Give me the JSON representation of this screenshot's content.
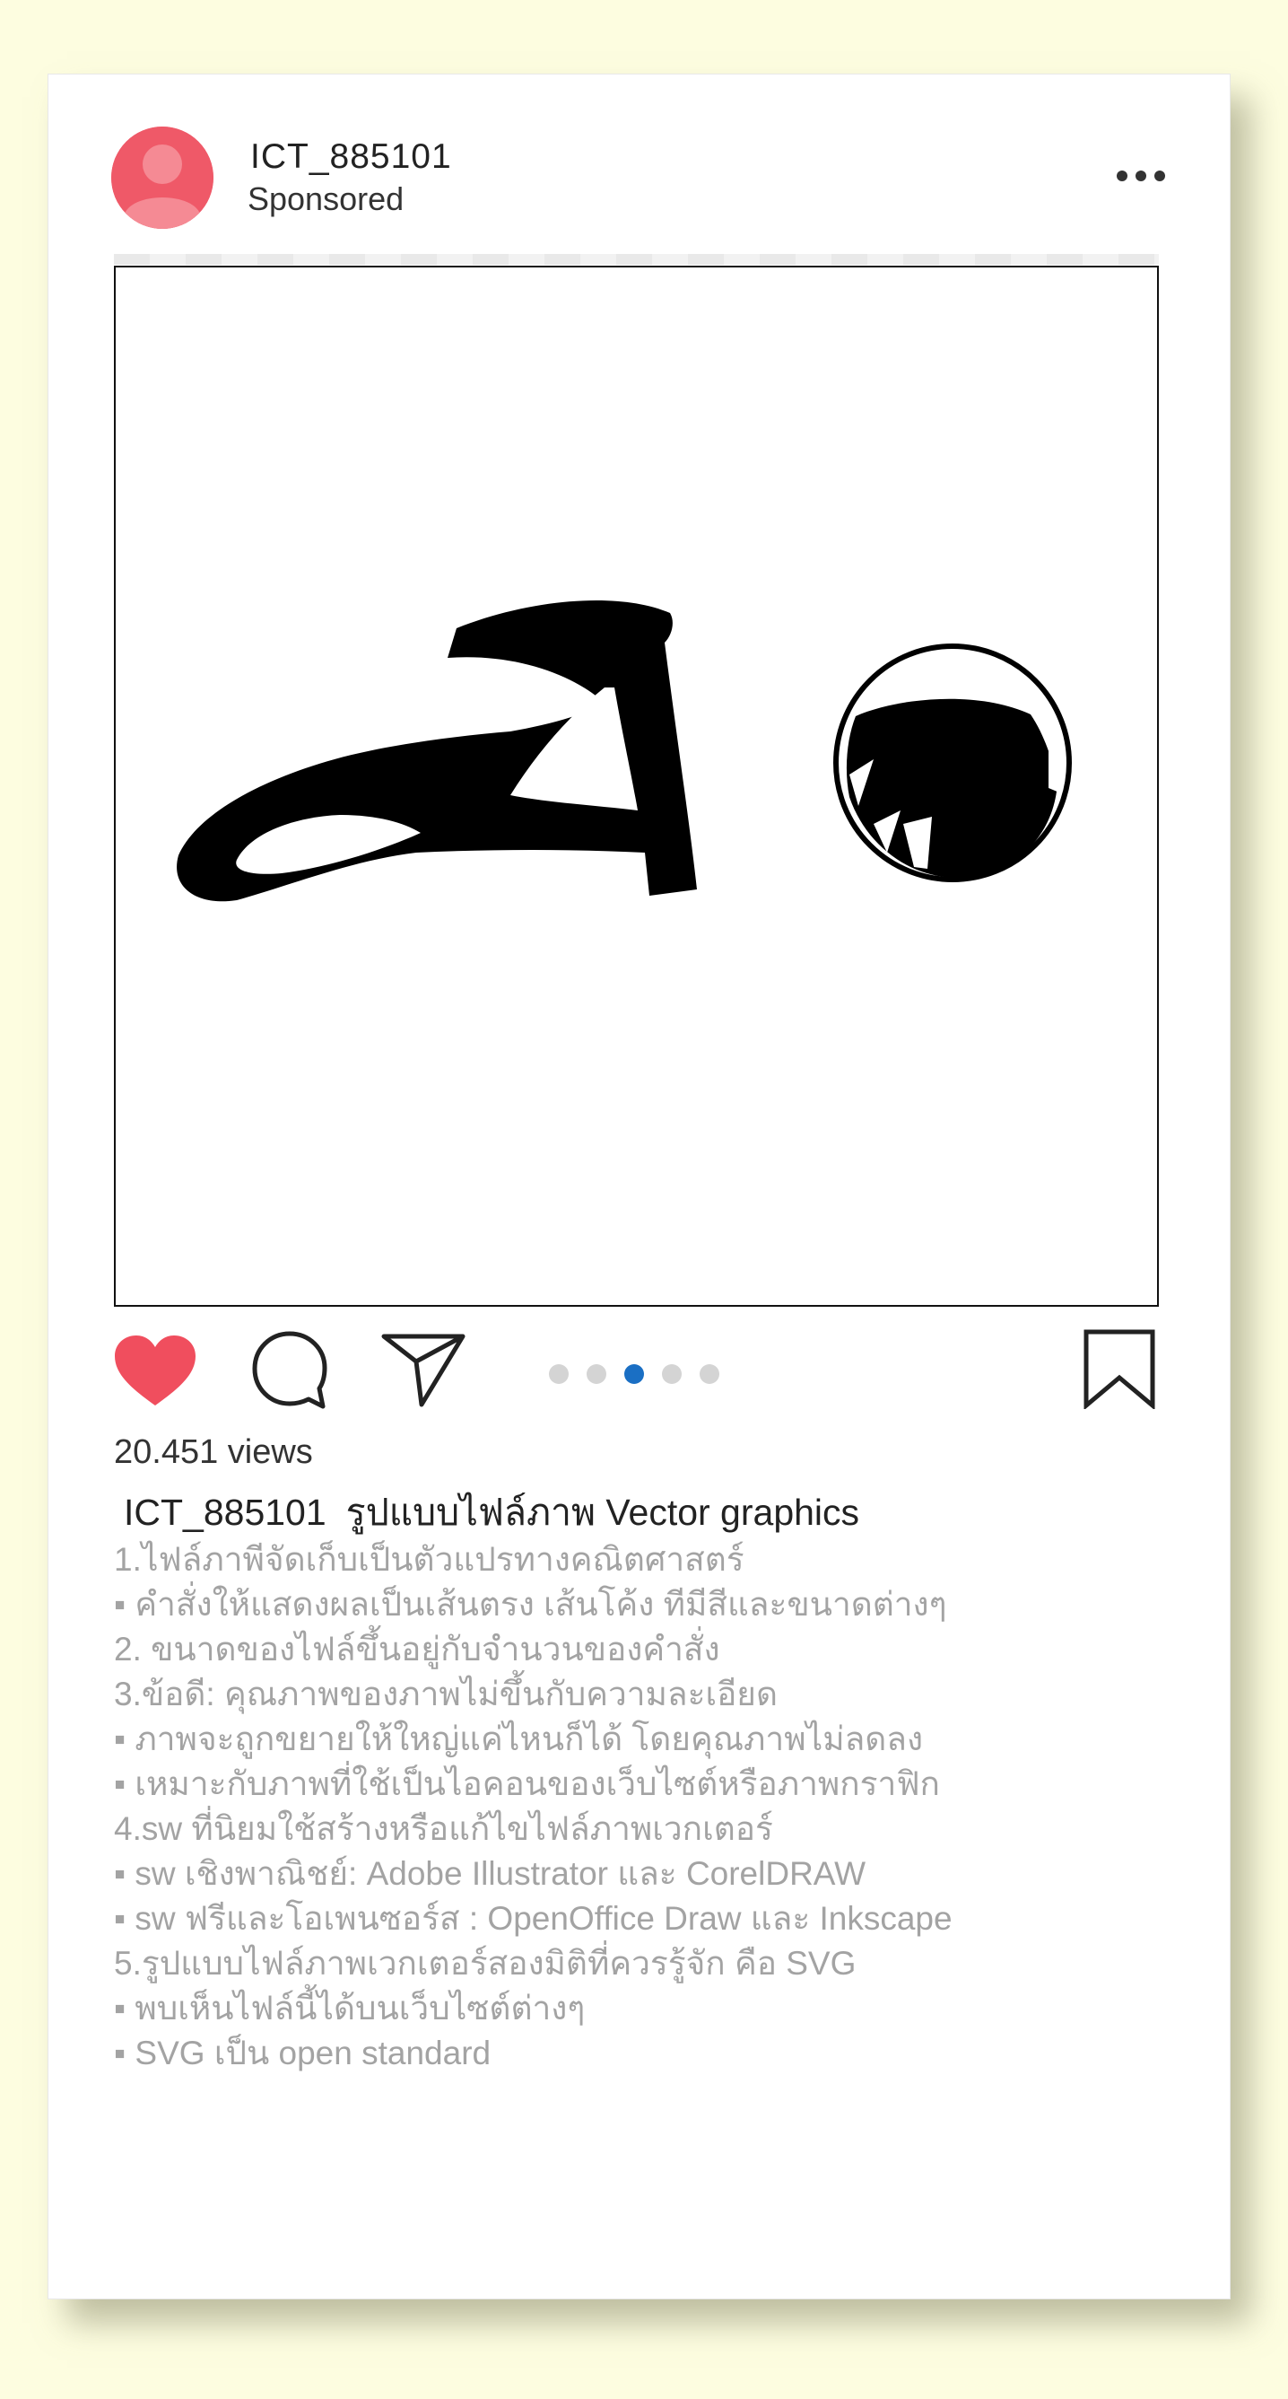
{
  "post": {
    "username": "ICT_885101",
    "sponsored_label": "Sponsored",
    "views": "20.451 views",
    "caption": {
      "username": "ICT_885101",
      "text": "รูปแบบไฟล์ภาพ Vector graphics"
    },
    "description_lines": [
      "1.ไฟล์ภาพีจัดเก็บเป็นตัวแปรทางคณิตศาสตร์",
      "▪ คำสั่งให้แสดงผลเป็นเส้นตรง เส้นโค้ง ทีมีสีและขนาดต่างๆ",
      "2. ขนาดของไฟล์ขึ้นอยู่กับจำนวนของคำสั่ง",
      "3.ข้อดี: คุณภาพของภาพไม่ขึ้นกับความละเอียด",
      "▪ ภาพจะถูกขยายให้ใหญ่แค่ไหนก็ได้ โดยคุณภาพไม่ลดลง",
      "▪ เหมาะกับภาพที่ใช้เป็นไอคอนของเว็บไซต์หรือภาพกราฟิก",
      "4.sw ที่นิยมใช้สร้างหรือแก้ไขไฟล์ภาพเวกเตอร์",
      "▪ sw เชิงพาณิชย์: Adobe Illustrator และ CorelDRAW",
      "▪ sw ฟรีและโอเพนซอร์ส : OpenOffice Draw และ Inkscape",
      "5.รูปแบบไฟล์ภาพเวกเตอร์สองมิติที่ควรรู้จัก คือ SVG",
      "▪ พบเห็นไฟล์นี้ได้บนเว็บไซต์ต่างๆ",
      "▪ SVG เป็น open standard"
    ],
    "carousel": {
      "total": 5,
      "active_index": 2
    }
  },
  "icons": {
    "avatar": "person-icon",
    "more": "ellipsis-icon",
    "like": "heart-icon",
    "comment": "speech-bubble-icon",
    "share": "paper-plane-icon",
    "save": "bookmark-icon"
  },
  "colors": {
    "background": "#fdfde0",
    "avatar": "#ef5968",
    "heart": "#f04e5e",
    "active_dot": "#1a6fc4",
    "inactive_dot": "#d4d4d4",
    "description_text": "#a3a3a3"
  }
}
